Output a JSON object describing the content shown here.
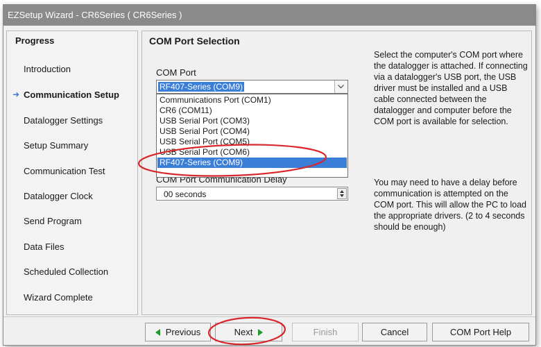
{
  "window": {
    "title": "EZSetup Wizard - CR6Series ( CR6Series )"
  },
  "sidebar": {
    "title": "Progress",
    "items": [
      {
        "label": "Introduction"
      },
      {
        "label": "Communication Setup",
        "active": true
      },
      {
        "label": "Datalogger Settings"
      },
      {
        "label": "Setup Summary"
      },
      {
        "label": "Communication Test"
      },
      {
        "label": "Datalogger Clock"
      },
      {
        "label": "Send Program"
      },
      {
        "label": "Data Files"
      },
      {
        "label": "Scheduled Collection"
      },
      {
        "label": "Wizard Complete"
      }
    ]
  },
  "main": {
    "section_title": "COM Port Selection",
    "com_port": {
      "label": "COM Port",
      "selected": "RF407-Series (COM9)",
      "options": [
        "Communications Port (COM1)",
        "CR6 (COM11)",
        "USB Serial Port (COM3)",
        "USB Serial Port (COM4)",
        "USB Serial Port (COM5)",
        "USB Serial Port (COM6)",
        "RF407-Series (COM9)"
      ],
      "highlighted_option": "RF407-Series (COM9)"
    },
    "delay": {
      "label": "COM Port Communication Delay",
      "value": "00 seconds"
    },
    "help_text_1": "Select the computer's COM port where the datalogger is attached.  If connecting via a datalogger's USB port, the USB driver must be installed and a USB cable connected between the datalogger and computer before the COM port is available for selection.",
    "help_text_2": "You may need to have a delay before communication is attempted on the COM port.  This will allow the PC to load the appropriate drivers. (2 to 4 seconds should be enough)"
  },
  "buttons": {
    "previous": "Previous",
    "next": "Next",
    "finish": "Finish",
    "cancel": "Cancel",
    "help": "COM Port Help"
  },
  "colors": {
    "selection": "#3a7ed8",
    "annotation": "#d9262b",
    "arrow_green": "#1c9a2c"
  }
}
